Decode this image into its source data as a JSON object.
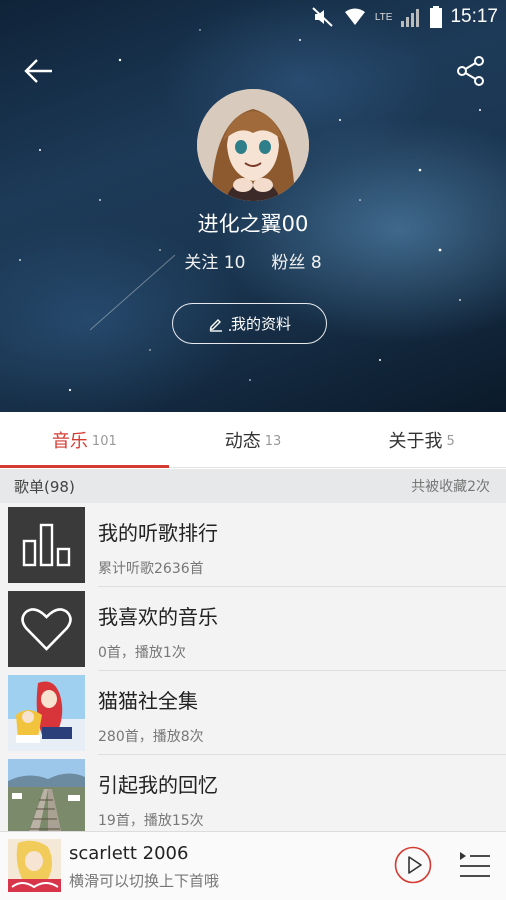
{
  "status_bar": {
    "time": "15:17",
    "network_label": "LTE"
  },
  "header": {
    "username": "进化之翼00",
    "following_label": "关注",
    "following_count": "10",
    "followers_label": "粉丝",
    "followers_count": "8",
    "profile_button_label": "我的资料"
  },
  "tabs": [
    {
      "label": "音乐",
      "count": "101",
      "active": true
    },
    {
      "label": "动态",
      "count": "13",
      "active": false
    },
    {
      "label": "关于我",
      "count": "5",
      "active": false
    }
  ],
  "playlist_section": {
    "title": "歌单(98)",
    "note": "共被收藏2次"
  },
  "playlists": [
    {
      "title": "我的听歌排行",
      "subtitle": "累计听歌2636首",
      "cover_icon": "bar-chart-icon"
    },
    {
      "title": "我喜欢的音乐",
      "subtitle": "0首，播放1次",
      "cover_icon": "heart-icon"
    },
    {
      "title": "猫猫社全集",
      "subtitle": "280首，播放8次",
      "cover_icon": "anime-cover"
    },
    {
      "title": "引起我的回忆",
      "subtitle": "19首，播放15次",
      "cover_icon": "railway-cover"
    }
  ],
  "player": {
    "title": "scarlett 2006",
    "hint": "横滑可以切换上下首哦"
  },
  "colors": {
    "accent": "#d43c33",
    "list_bg": "#f3f3f3",
    "section_bg": "#e6e8ea",
    "icon_tile": "#3a3a3a"
  }
}
